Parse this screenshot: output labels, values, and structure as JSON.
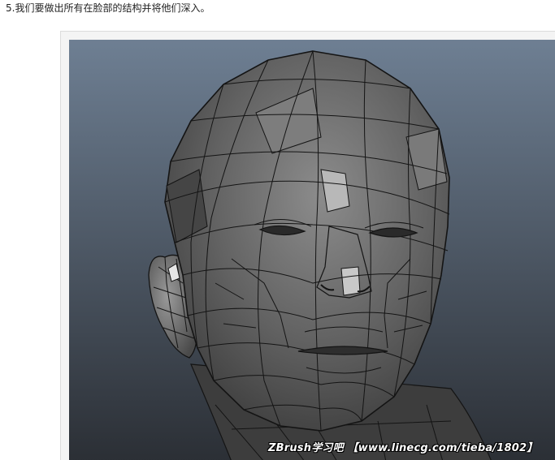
{
  "article": {
    "step_text": "5.我们要做出所有在脸部的结构并将他们深入。"
  },
  "figure": {
    "image_subject": "head-wireframe-icon",
    "watermark_prefix": "ZBrush学习吧",
    "watermark_link": "【www.linecg.com/tieba/1802】"
  },
  "colors": {
    "viewport_top": "#6e7f93",
    "viewport_bottom": "#2b2f35",
    "mesh_light": "#b5b5b5",
    "mesh_mid": "#6a6a6a",
    "mesh_dark": "#3a3a3a",
    "wire": "#141414"
  }
}
